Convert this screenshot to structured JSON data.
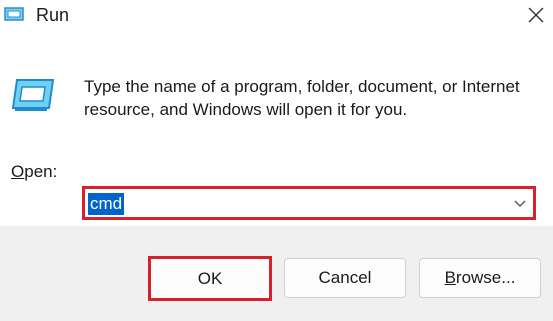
{
  "window": {
    "title": "Run",
    "title_icon": "run-icon",
    "close_icon": "close-icon"
  },
  "main": {
    "icon": "run-dialog-icon",
    "description": "Type the name of a program, folder, document, or Internet resource, and Windows will open it for you.",
    "open_label_prefix": "O",
    "open_label_rest": "pen:",
    "open_value": "cmd",
    "dropdown_icon": "chevron-down-icon"
  },
  "buttons": {
    "ok": "OK",
    "cancel": "Cancel",
    "browse_prefix": "B",
    "browse_rest": "rowse..."
  },
  "colors": {
    "highlight": "#d7202e",
    "selection": "#0063d0"
  }
}
